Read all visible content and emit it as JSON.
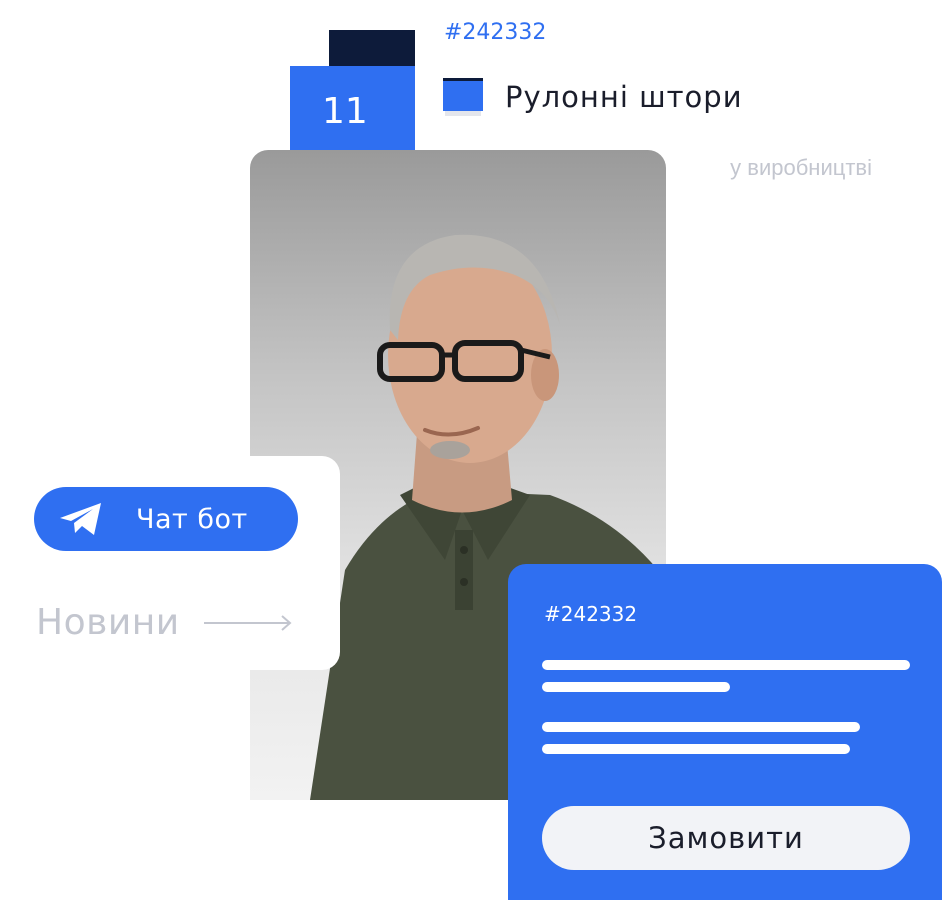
{
  "badge": {
    "number": "11"
  },
  "product_card": {
    "order_code": "#242332",
    "icon": "roller-blind-icon",
    "product_name": "Рулонні штори",
    "status": "у виробництві"
  },
  "menu_card": {
    "chat_bot": {
      "icon": "telegram-icon",
      "label": "Чат бот"
    },
    "news": {
      "label": "Новини",
      "icon": "arrow-right-icon"
    }
  },
  "order_card": {
    "order_code": "#242332",
    "order_button_label": "Замовити"
  },
  "colors": {
    "accent": "#2f6ff1",
    "dark": "#0d1b3a",
    "muted_text": "#c3c6cf",
    "button_light": "#f2f3f7"
  }
}
